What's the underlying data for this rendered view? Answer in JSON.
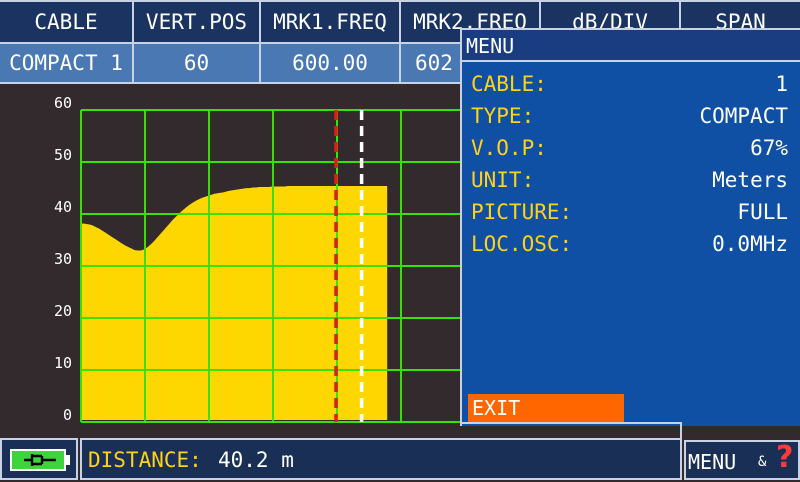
{
  "header": {
    "columns": [
      {
        "title": "CABLE",
        "value": "COMPACT 1"
      },
      {
        "title": "VERT.POS",
        "value": "60"
      },
      {
        "title": "MRK1.FREQ",
        "value": "600.00"
      },
      {
        "title": "MRK2.FREQ",
        "value": "602"
      },
      {
        "title": "dB/DIV",
        "value": ""
      },
      {
        "title": "SPAN",
        "value": ""
      }
    ]
  },
  "chart_data": {
    "type": "area",
    "title": "",
    "xlabel": "",
    "ylabel": "",
    "ylim": [
      0,
      60
    ],
    "y_ticks": [
      "60",
      "50",
      "40",
      "30",
      "20",
      "10",
      "0"
    ],
    "grid": true,
    "x": [
      0,
      0.5,
      1,
      1.5,
      2,
      2.5,
      3,
      3.5,
      4,
      4.5,
      5,
      5.5,
      6,
      6.5,
      7,
      7.5,
      8,
      8.5,
      9,
      9.5,
      10,
      10.5,
      11,
      11.5,
      12,
      12.5,
      13,
      13.5,
      14,
      14.5,
      15,
      15.5,
      16,
      16.5,
      17,
      17.5,
      18,
      18.5,
      19,
      19.5,
      20,
      20.5,
      21,
      21.5,
      22,
      22.5,
      23,
      23.5,
      24,
      24.5,
      25,
      25.5,
      26,
      26.5,
      27,
      27.5,
      28,
      28.5,
      29,
      29.5,
      30,
      30.5,
      31,
      31.5,
      32,
      32.5,
      33,
      33.5,
      34,
      34.5,
      35,
      35.5,
      36,
      36.5,
      37,
      37.5,
      38,
      38.5,
      39,
      39.5,
      40,
      40.5,
      41,
      41.5,
      42,
      42.5,
      43,
      43.5,
      44,
      44.5,
      45,
      45.5,
      46,
      46.5,
      47,
      47.5,
      48
    ],
    "series": [
      {
        "color": "#ffd700",
        "values": [
          37.8,
          37.8,
          37.7,
          37.6,
          37.4,
          37.1,
          36.8,
          36.4,
          36,
          35.6,
          35.2,
          34.8,
          34.4,
          34,
          33.6,
          33.3,
          33,
          32.7,
          32.6,
          32.6,
          32.8,
          33.2,
          33.7,
          34.3,
          35,
          35.7,
          36.4,
          37.1,
          37.8,
          38.5,
          39.1,
          39.7,
          40.3,
          40.8,
          41.3,
          41.7,
          42.1,
          42.4,
          42.7,
          42.9,
          43.1,
          43.3,
          43.5,
          43.6,
          43.7,
          43.8,
          44,
          44.1,
          44.2,
          44.3,
          44.4,
          44.5,
          44.6,
          44.6,
          44.7,
          44.7,
          44.8,
          44.8,
          44.8,
          44.8,
          44.9,
          44.9,
          44.9,
          44.9,
          44.9,
          45,
          45,
          45,
          45,
          45,
          45,
          45,
          45,
          45,
          45,
          45,
          45,
          45,
          45,
          45,
          45,
          45,
          45,
          45,
          45,
          45,
          45,
          45,
          45,
          45,
          45,
          45,
          45,
          45,
          45,
          45,
          45
        ]
      }
    ],
    "markers": [
      {
        "x": 40,
        "color": "#e01b1b"
      },
      {
        "x": 44,
        "color": "#ffffff"
      }
    ]
  },
  "menu": {
    "title": "MENU",
    "items": [
      {
        "label": "CABLE:",
        "value": "1"
      },
      {
        "label": "TYPE:",
        "value": "COMPACT"
      },
      {
        "label": "V.O.P:",
        "value": "67%"
      },
      {
        "label": "UNIT:",
        "value": "Meters"
      },
      {
        "label": "PICTURE:",
        "value": "FULL"
      },
      {
        "label": "LOC.OSC:",
        "value": "0.0MHz"
      }
    ],
    "exit_label": "EXIT"
  },
  "status": {
    "distance_label": "DISTANCE:",
    "distance_value": "40.2 m",
    "menu_button_label": "MENU",
    "menu_button_amp": "&",
    "help_glyph": "?"
  },
  "colors": {
    "grid": "#39e000",
    "trace_fill": "#ffd700",
    "battery": "#3cd63c"
  }
}
